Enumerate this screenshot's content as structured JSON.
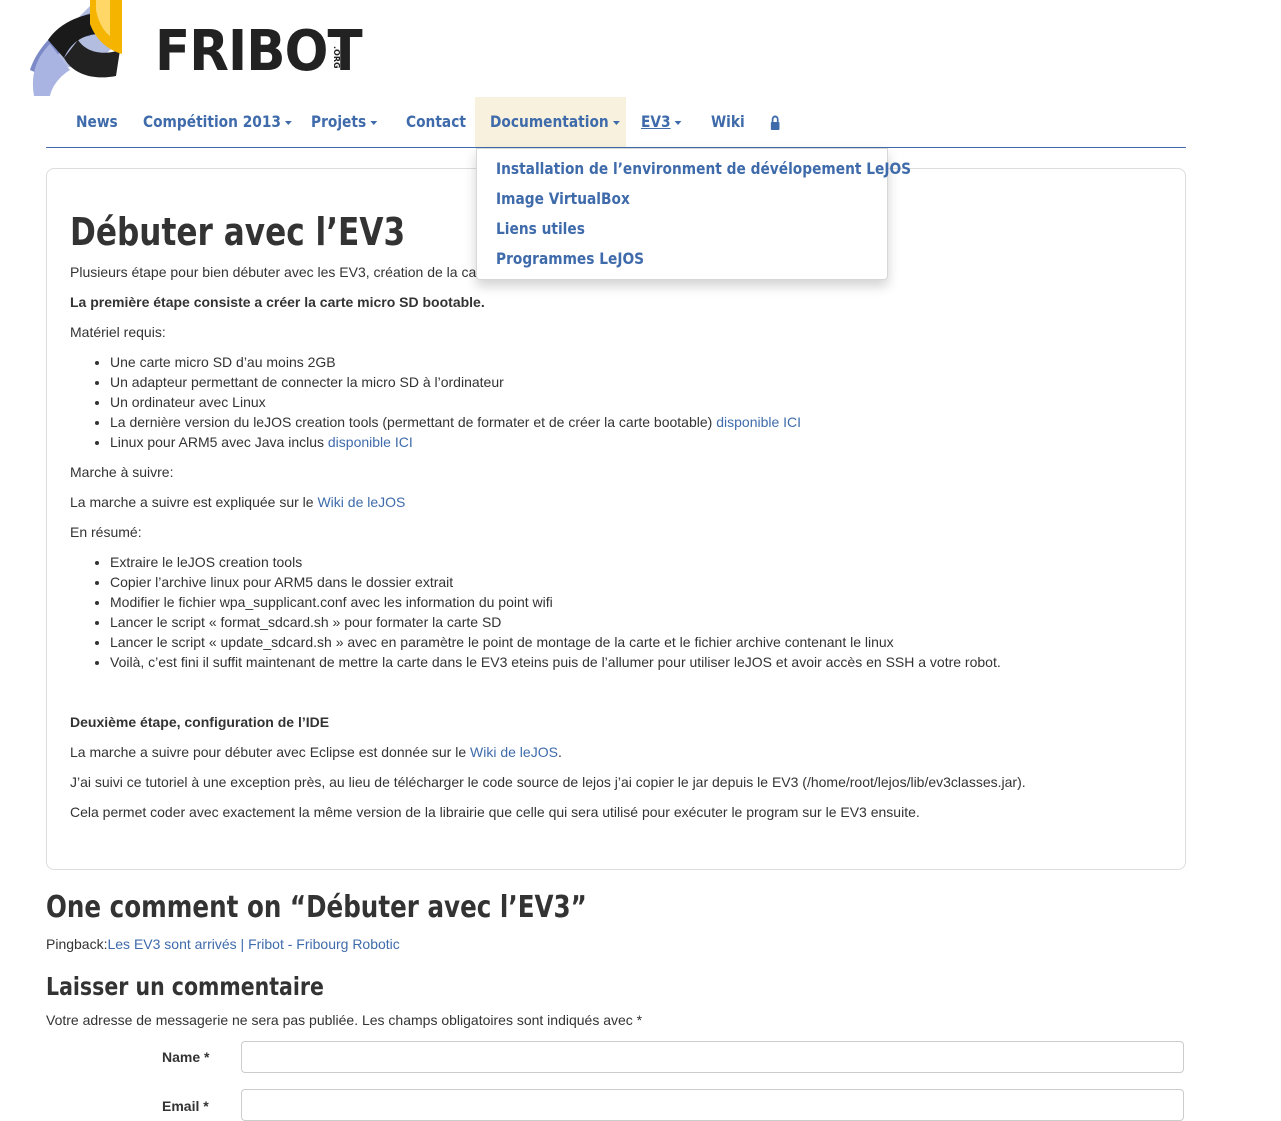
{
  "logo": {
    "text": "FRIBOT",
    "suffix": ".ORG"
  },
  "nav": {
    "items": [
      {
        "label": "News",
        "caret": false
      },
      {
        "label": "Compétition 2013",
        "caret": true
      },
      {
        "label": "Projets",
        "caret": true
      },
      {
        "label": "Contact",
        "caret": false
      },
      {
        "label": "Documentation",
        "caret": true
      },
      {
        "label": "EV3",
        "caret": true
      },
      {
        "label": "Wiki",
        "caret": false
      }
    ],
    "lock_icon": "lock-icon"
  },
  "dropdown": {
    "items": [
      "Installation de l’environment de dévélopement LeJOS",
      "Image VirtualBox",
      "Liens utiles",
      "Programmes LeJOS"
    ]
  },
  "article": {
    "title": "Débuter avec l’EV3",
    "intro": "Plusieurs étape pour bien débuter avec les EV3, création de la ca",
    "step1_heading": "La première étape consiste a créer la carte micro SD bootable.",
    "materials_label": "Matériel requis:",
    "materials": [
      {
        "text": "Une carte micro SD d’au moins 2GB",
        "link": ""
      },
      {
        "text": "Un adapteur permettant de connecter la micro SD à l’ordinateur",
        "link": ""
      },
      {
        "text": "Un ordinateur avec Linux",
        "link": ""
      },
      {
        "text": "La dernière version du leJOS creation tools (permettant de formater et de créer la carte bootable) ",
        "link": "disponible ICI"
      },
      {
        "text": "Linux pour ARM5 avec Java inclus ",
        "link": "disponible ICI"
      }
    ],
    "procedure_label": "Marche à suivre:",
    "procedure_text": "La marche a suivre est expliquée sur le ",
    "procedure_link": "Wiki de leJOS",
    "summary_label": "En résumé:",
    "summary": [
      "Extraire le leJOS creation tools",
      "Copier l’archive linux pour ARM5 dans le dossier extrait",
      "Modifier le fichier wpa_supplicant.conf avec les information du point wifi",
      "Lancer le script « format_sdcard.sh » pour formater la carte SD",
      "Lancer le script « update_sdcard.sh » avec en paramètre le point de montage de la carte et le fichier archive contenant le linux",
      "Voilà, c’est fini il suffit maintenant de mettre la carte dans le EV3 eteins puis de l’allumer pour utiliser leJOS et avoir accès en SSH a votre robot."
    ],
    "step2_heading": "Deuxième étape, configuration de l’IDE",
    "step2_text": "La marche a suivre pour débuter avec Eclipse est donnée sur le ",
    "step2_link": "Wiki de leJOS",
    "step2_after": ".",
    "step2_p2": "J’ai suivi ce tutoriel à une exception près, au lieu de télécharger le code source de lejos j’ai copier le jar depuis le EV3 (/home/root/lejos/lib/ev3classes.jar).",
    "step2_p3": "Cela permet coder avec exactement la même version de la librairie que celle qui sera utilisé pour exécuter le program sur le EV3 ensuite."
  },
  "comments": {
    "heading": "One comment on “Débuter avec l’EV3”",
    "pingback_label": "Pingback:",
    "pingback_link": "Les EV3 sont arrivés | Fribot - Fribourg Robotic"
  },
  "reply": {
    "heading": "Laisser un commentaire",
    "notice": "Votre adresse de messagerie ne sera pas publiée. Les champs obligatoires sont indiqués avec *",
    "name_label": "Name *",
    "email_label": "Email *",
    "name_value": "",
    "email_value": ""
  },
  "colors": {
    "link": "#3f6bab",
    "nav_active_bg": "#f7f1de",
    "logo_yellow": "#f5b400"
  }
}
